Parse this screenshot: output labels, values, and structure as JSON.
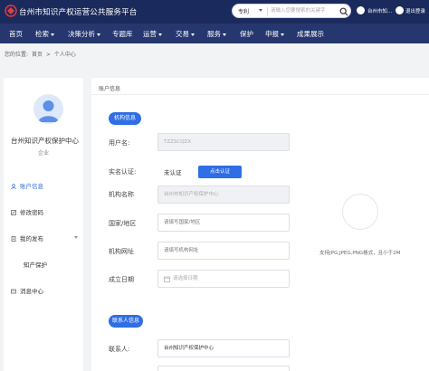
{
  "header": {
    "site_title": "台州市知识产权运营公共服务平台",
    "search": {
      "scope": "专利",
      "placeholder": "请输入您要搜索的关键字"
    },
    "user_name": "台州市知...",
    "logout_label": "退出登录"
  },
  "nav": {
    "items": [
      {
        "label": "首页",
        "has_menu": false
      },
      {
        "label": "检索",
        "has_menu": true
      },
      {
        "label": "决策分析",
        "has_menu": true
      },
      {
        "label": "专题库",
        "has_menu": false
      },
      {
        "label": "运营",
        "has_menu": true
      },
      {
        "label": "交易",
        "has_menu": true
      },
      {
        "label": "服务",
        "has_menu": true
      },
      {
        "label": "保护",
        "has_menu": false
      },
      {
        "label": "申报",
        "has_menu": true
      },
      {
        "label": "成果展示",
        "has_menu": false
      }
    ]
  },
  "breadcrumb": {
    "prefix": "您的位置:",
    "items": [
      "首页",
      ">",
      "个人中心"
    ]
  },
  "sidebar": {
    "org_name": "台州知识产权保护中心",
    "org_type": "企业",
    "items": [
      {
        "label": "账户信息",
        "active": true
      },
      {
        "label": "修改密码",
        "active": false
      },
      {
        "label": "我的发布",
        "active": false
      },
      {
        "label": "知产保护",
        "active": false,
        "sub": true
      },
      {
        "label": "消息中心",
        "active": false
      }
    ]
  },
  "main": {
    "title": "账户信息",
    "org_section": "机构信息",
    "contact_section": "联系人信息",
    "fields": {
      "username": {
        "label": "用户名:",
        "value": "TZZSCQZX"
      },
      "real_name": {
        "label": "实名认证:",
        "value": "未认证",
        "button": "点击认证"
      },
      "org_name": {
        "label": "机构名称",
        "value": "台州市知识产权保护中心"
      },
      "country": {
        "label": "国家/地区",
        "placeholder": "请填写国家/地区"
      },
      "website": {
        "label": "机构网址",
        "placeholder": "请填写机构网址"
      },
      "founded": {
        "label": "成立日期",
        "placeholder": "请选择日期"
      },
      "contact": {
        "label": "联系人:",
        "value": "台州知识产权保护中心"
      }
    },
    "upload_hint": "支持JPG,JPEG,PNG格式，且小于2M"
  },
  "colors": {
    "header_bg": "#1b2a5c",
    "nav_bg": "#25376e",
    "accent": "#2e6ee6"
  }
}
